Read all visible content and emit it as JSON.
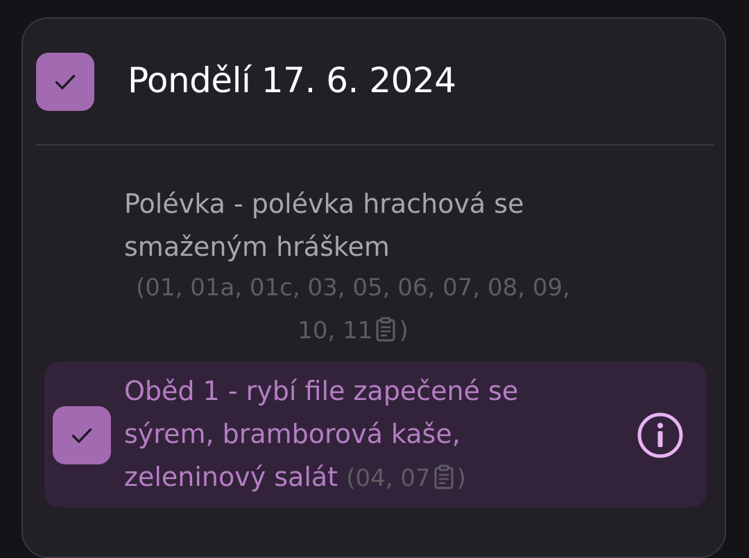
{
  "day": {
    "title": "Pondělí 17. 6. 2024",
    "checked": true
  },
  "soup": {
    "text": "Polévka - polévka hrachová se smaženým hráškem",
    "codes_before_icon": "(01, 01a, 01c, 03, 05, 06, 07, 08, 09, 10, 11",
    "codes_after_icon": ")"
  },
  "lunch1": {
    "text": "Oběd 1 - rybí file zapečené se sýrem, bramborová kaše, zeleninový salát",
    "codes_before_icon": "(04, 07",
    "codes_after_icon": ")",
    "checked": true
  },
  "icons": {
    "day_checkbox": "check-icon",
    "soup_notes": "clipboard-icon",
    "lunch_checkbox": "check-icon",
    "lunch_notes": "clipboard-icon",
    "lunch_info": "info-icon"
  },
  "colors": {
    "background": "#141318",
    "card": "#221f26",
    "accent": "#a26ab0",
    "selected_row": "#32233a",
    "selected_text": "#b57ec4",
    "info_icon": "#e7b2f2"
  }
}
